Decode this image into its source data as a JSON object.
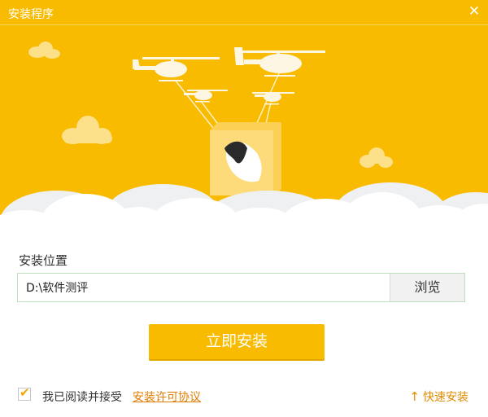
{
  "window": {
    "title": "安装程序",
    "close_glyph": "✕"
  },
  "illustration": {
    "description_icon": "helicopters-carrying-box-icon",
    "colors": {
      "banner": "#f9bb00",
      "helicopter": "#fdf6e3",
      "cloud_light": "#fde08a",
      "cloud_white": "#ffffff",
      "box": "#fdda7a"
    }
  },
  "install": {
    "location_label": "安装位置",
    "path_value": "D:\\软件测评",
    "browse_label": "浏览",
    "install_button": "立即安装"
  },
  "footer": {
    "agree_checked": true,
    "agree_text": "我已阅读并接受",
    "license_link": "安装许可协议",
    "quick_install": "快速安装",
    "quick_icon": "up-arrow-icon"
  },
  "colors": {
    "accent": "#f9bb00",
    "link": "#e07d00"
  }
}
